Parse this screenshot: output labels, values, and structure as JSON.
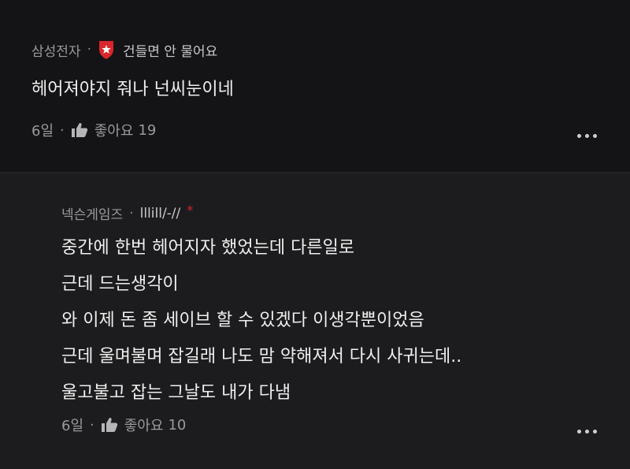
{
  "comments": [
    {
      "author": "삼성전자",
      "badge_icon": "shield-star-icon",
      "flair": "건들면 안 물어요",
      "lines": [
        "헤어져야지 줘나 넌씨눈이네"
      ],
      "age": "6일",
      "like_label": "좋아요",
      "like_count": "19"
    },
    {
      "author": "넥슨게임즈",
      "flair": "lllill/-//",
      "new_marker": "*",
      "lines": [
        "중간에 한번 헤어지자 했었는데 다른일로",
        "근데 드는생각이",
        "와 이제 돈 좀 세이브 할 수 있겠다 이생각뿐이었음",
        "근데 울며불며 잡길래 나도 맘 약해져서 다시 사귀는데..",
        "울고불고 잡는 그날도 내가 다냄"
      ],
      "age": "6일",
      "like_label": "좋아요",
      "like_count": "10"
    }
  ],
  "separator": "·",
  "colors": {
    "accent_red": "#d9262c",
    "background": "#141416",
    "reply_background": "#1c1c1e"
  }
}
